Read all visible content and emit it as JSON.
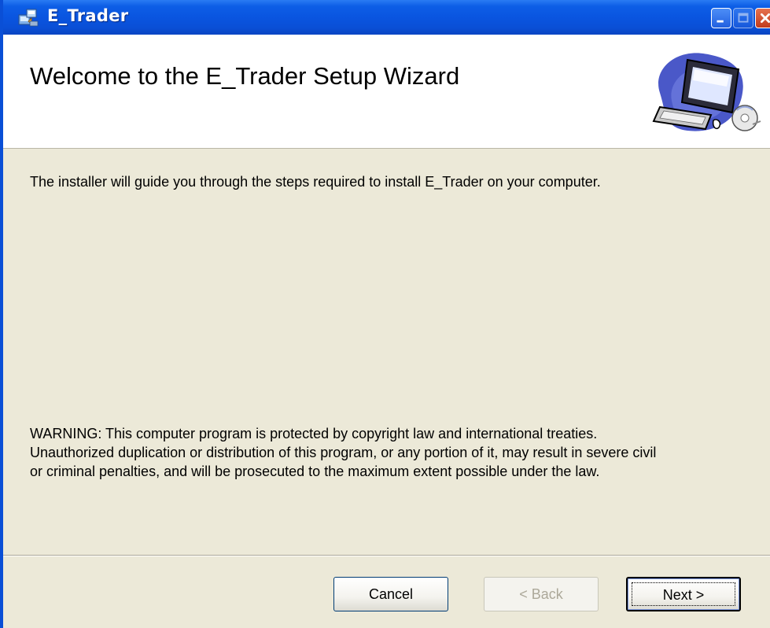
{
  "window": {
    "title": "E_Trader",
    "icon": "installer-icon"
  },
  "titlebar_buttons": {
    "minimize": "minimize-icon",
    "maximize": "maximize-icon",
    "close": "close-icon"
  },
  "banner": {
    "title": "Welcome to the E_Trader Setup Wizard",
    "art": "computer-cd-icon"
  },
  "body": {
    "intro": "The installer will guide you through the steps required to install E_Trader on your computer.",
    "warning": "WARNING: This computer program is protected by copyright law and international treaties.\nUnauthorized duplication or distribution of this program, or any portion of it, may result in severe civil\nor criminal penalties, and will be prosecuted to the maximum extent possible under the law."
  },
  "buttons": {
    "cancel": "Cancel",
    "back": "< Back",
    "next": "Next >"
  },
  "colors": {
    "titlebar": "#0a4fd6",
    "dialog_bg": "#ece9d8",
    "banner_bg": "#ffffff",
    "disabled_text": "#aca899"
  }
}
